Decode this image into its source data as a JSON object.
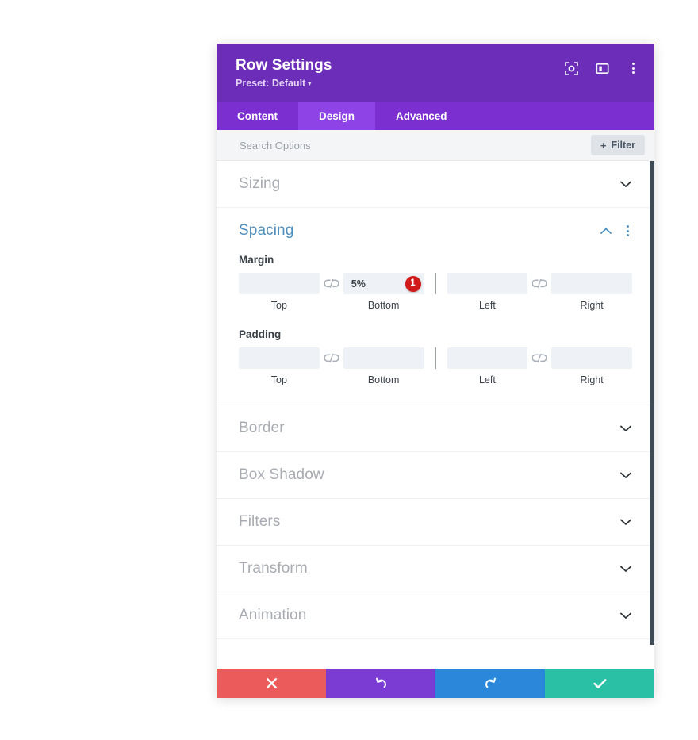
{
  "header": {
    "title": "Row Settings",
    "preset_label": "Preset: Default",
    "icons": [
      {
        "name": "focus-icon"
      },
      {
        "name": "layout-panel-icon"
      },
      {
        "name": "more-options-icon"
      }
    ]
  },
  "tabs": [
    {
      "label": "Content",
      "active": false
    },
    {
      "label": "Design",
      "active": true
    },
    {
      "label": "Advanced",
      "active": false
    }
  ],
  "search": {
    "placeholder": "Search Options",
    "value": "",
    "filter_label": "Filter",
    "filter_plus": "+"
  },
  "sections": [
    {
      "title": "Sizing",
      "open": false
    },
    {
      "title": "Spacing",
      "open": true
    },
    {
      "title": "Border",
      "open": false
    },
    {
      "title": "Box Shadow",
      "open": false
    },
    {
      "title": "Filters",
      "open": false
    },
    {
      "title": "Transform",
      "open": false
    },
    {
      "title": "Animation",
      "open": false
    }
  ],
  "spacing": {
    "margin": {
      "label": "Margin",
      "top": {
        "value": "",
        "label": "Top"
      },
      "bottom": {
        "value": "5%",
        "label": "Bottom",
        "badge": "1"
      },
      "left": {
        "value": "",
        "label": "Left"
      },
      "right": {
        "value": "",
        "label": "Right"
      }
    },
    "padding": {
      "label": "Padding",
      "top": {
        "value": "",
        "label": "Top"
      },
      "bottom": {
        "value": "",
        "label": "Bottom"
      },
      "left": {
        "value": "",
        "label": "Left"
      },
      "right": {
        "value": "",
        "label": "Right"
      }
    }
  },
  "footer": {
    "buttons": [
      {
        "name": "cancel-button",
        "icon": "close-icon",
        "color": "#EC5B5B"
      },
      {
        "name": "undo-button",
        "icon": "undo-icon",
        "color": "#7B3CD4"
      },
      {
        "name": "redo-button",
        "icon": "redo-icon",
        "color": "#2B87DA"
      },
      {
        "name": "save-button",
        "icon": "check-icon",
        "color": "#2AC0A5"
      }
    ]
  },
  "colors": {
    "header_purple": "#6C2EB9",
    "tabbar_purple": "#7B2FD0",
    "tab_active_purple": "#8D43E6",
    "accent_blue": "#4C8FBF",
    "badge_red": "#D21A1A"
  }
}
